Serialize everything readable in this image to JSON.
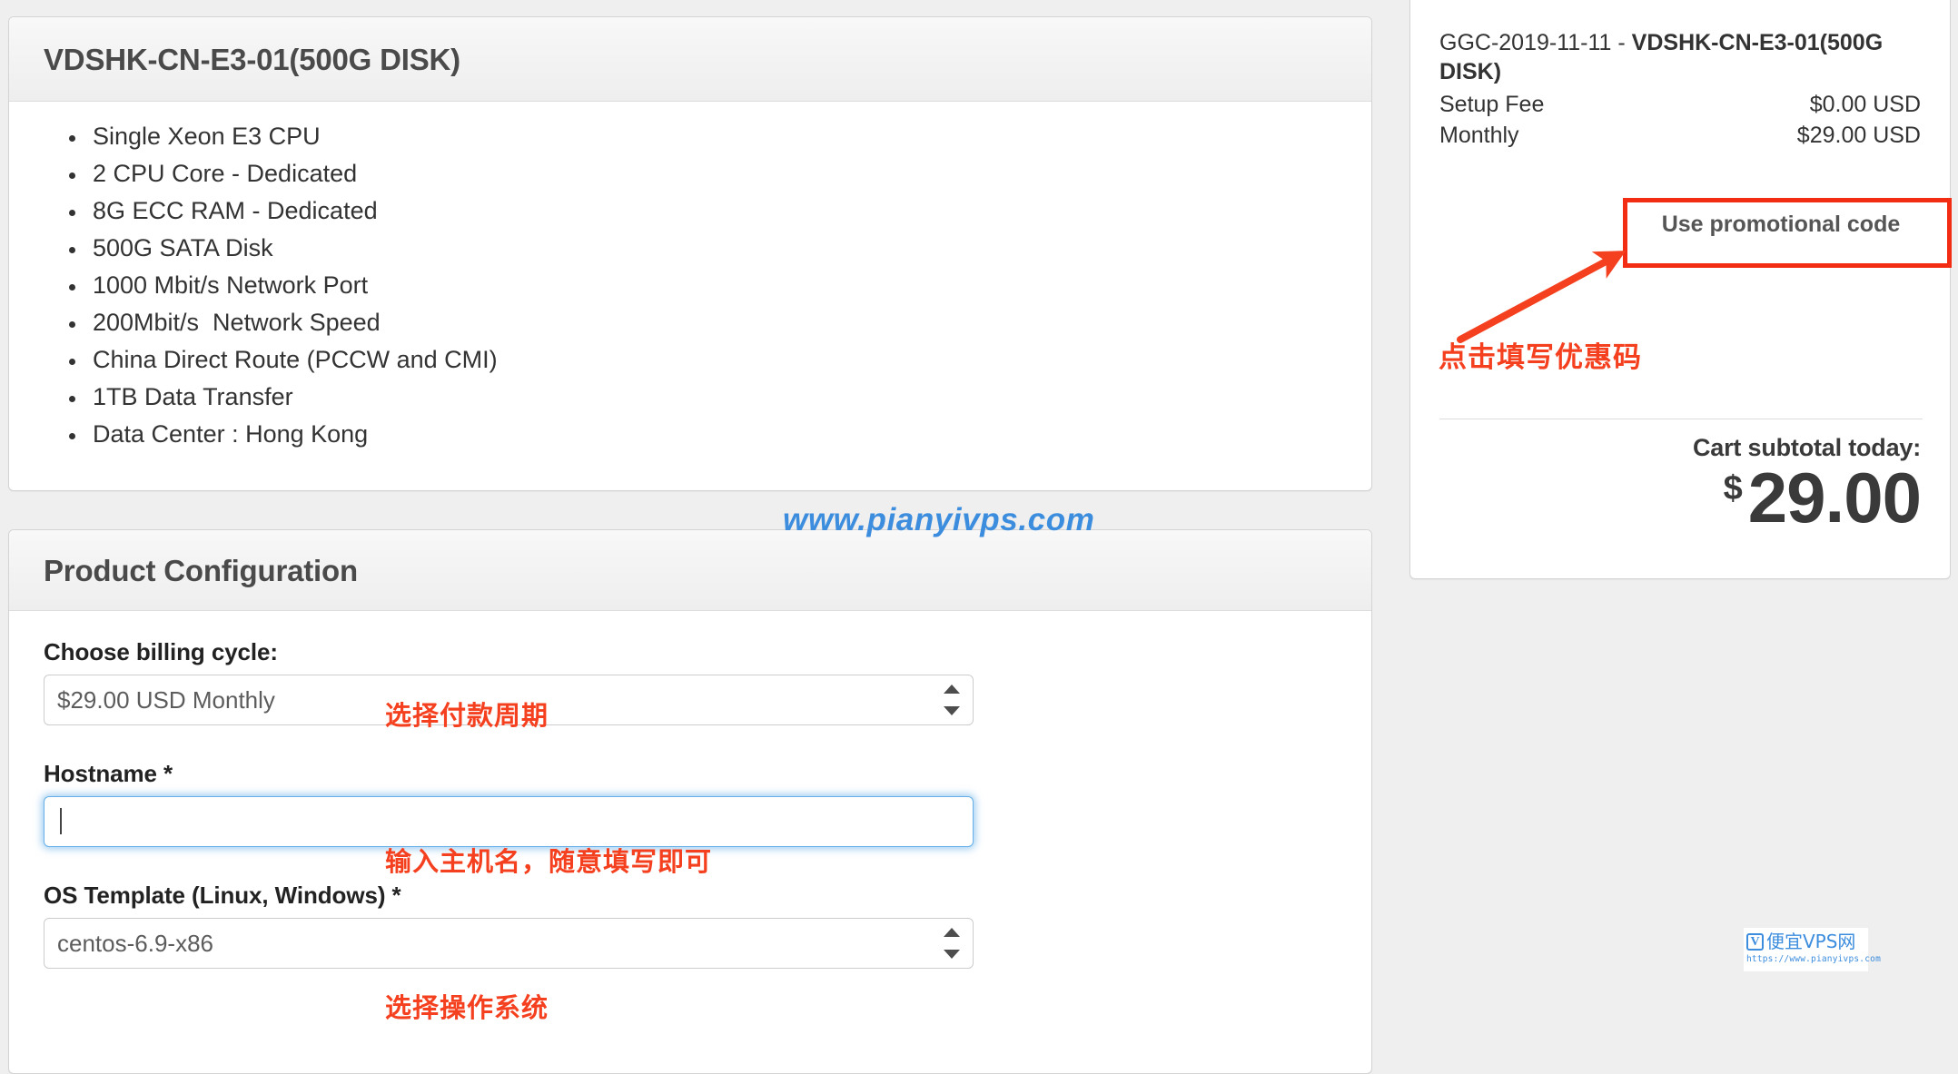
{
  "product_panel": {
    "title": "VDSHK-CN-E3-01(500G DISK)",
    "features": [
      "Single Xeon E3 CPU",
      "2 CPU Core - Dedicated",
      "8G ECC RAM - Dedicated",
      "500G SATA Disk",
      "1000 Mbit/s Network Port",
      "200Mbit/s  Network Speed",
      "China Direct Route (PCCW and CMI)",
      "1TB Data Transfer",
      "Data Center : Hong Kong"
    ]
  },
  "config_panel": {
    "title": "Product Configuration",
    "billing": {
      "label": "Choose billing cycle:",
      "value": "$29.00 USD Monthly"
    },
    "hostname": {
      "label": "Hostname *",
      "value": "",
      "placeholder": ""
    },
    "os_template": {
      "label": "OS Template (Linux, Windows) *",
      "value": "centos-6.9-x86"
    }
  },
  "cart": {
    "item_prefix": "GGC-2019-11-11 - ",
    "item_product": "VDSHK-CN-E3-01(500G DISK)",
    "lines": [
      {
        "label": "Setup Fee",
        "amount": "$0.00 USD"
      },
      {
        "label": "Monthly",
        "amount": "$29.00 USD"
      }
    ],
    "promo_button": "Use promotional code",
    "subtotal_label": "Cart subtotal today:",
    "currency_symbol": "$",
    "subtotal_amount": "29.00"
  },
  "annotations": {
    "billing": "选择付款周期",
    "hostname": "输入主机名，随意填写即可",
    "os_template": "选择操作系统",
    "promo": "点击填写优惠码",
    "highlight_color": "#f22d13",
    "text_color": "#f4401f"
  },
  "watermark": {
    "text": "www.pianyivps.com",
    "color": "#3c8dde"
  },
  "logo": {
    "mark": "V",
    "name": "便宜VPS网",
    "url": "https://www.pianyivps.com"
  }
}
